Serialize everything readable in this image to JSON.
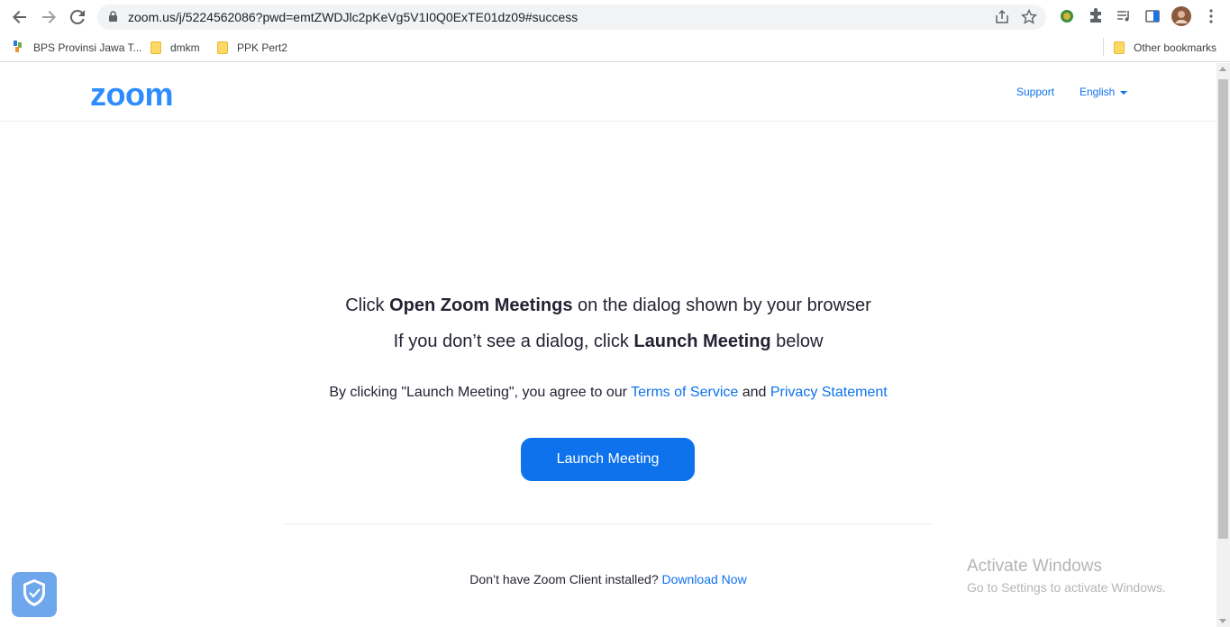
{
  "browser": {
    "url": "zoom.us/j/5224562086?pwd=emtZWDJlc2pKeVg5V1I0Q0ExTE01dz09#success"
  },
  "bookmarks": {
    "items": [
      {
        "label": "BPS Provinsi Jawa T..."
      },
      {
        "label": "dmkm"
      },
      {
        "label": "PPK Pert2"
      }
    ],
    "other": "Other bookmarks"
  },
  "header": {
    "logo": "zoom",
    "support": "Support",
    "language": "English"
  },
  "main": {
    "line1_pre": "Click ",
    "line1_bold": "Open Zoom Meetings",
    "line1_post": " on the dialog shown by your browser",
    "line2_pre": "If you don’t see a dialog, click ",
    "line2_bold": "Launch Meeting",
    "line2_post": " below",
    "agree_pre": "By clicking \"Launch Meeting\", you agree to our ",
    "terms": "Terms of Service",
    "agree_and": " and ",
    "privacy": "Privacy Statement",
    "launch_button": "Launch Meeting",
    "download_pre": "Don’t have Zoom Client installed? ",
    "download_link": "Download Now"
  },
  "watermark": {
    "title": "Activate Windows",
    "subtitle": "Go to Settings to activate Windows."
  },
  "colors": {
    "accent": "#0e72ed",
    "logo": "#2d8cff"
  }
}
